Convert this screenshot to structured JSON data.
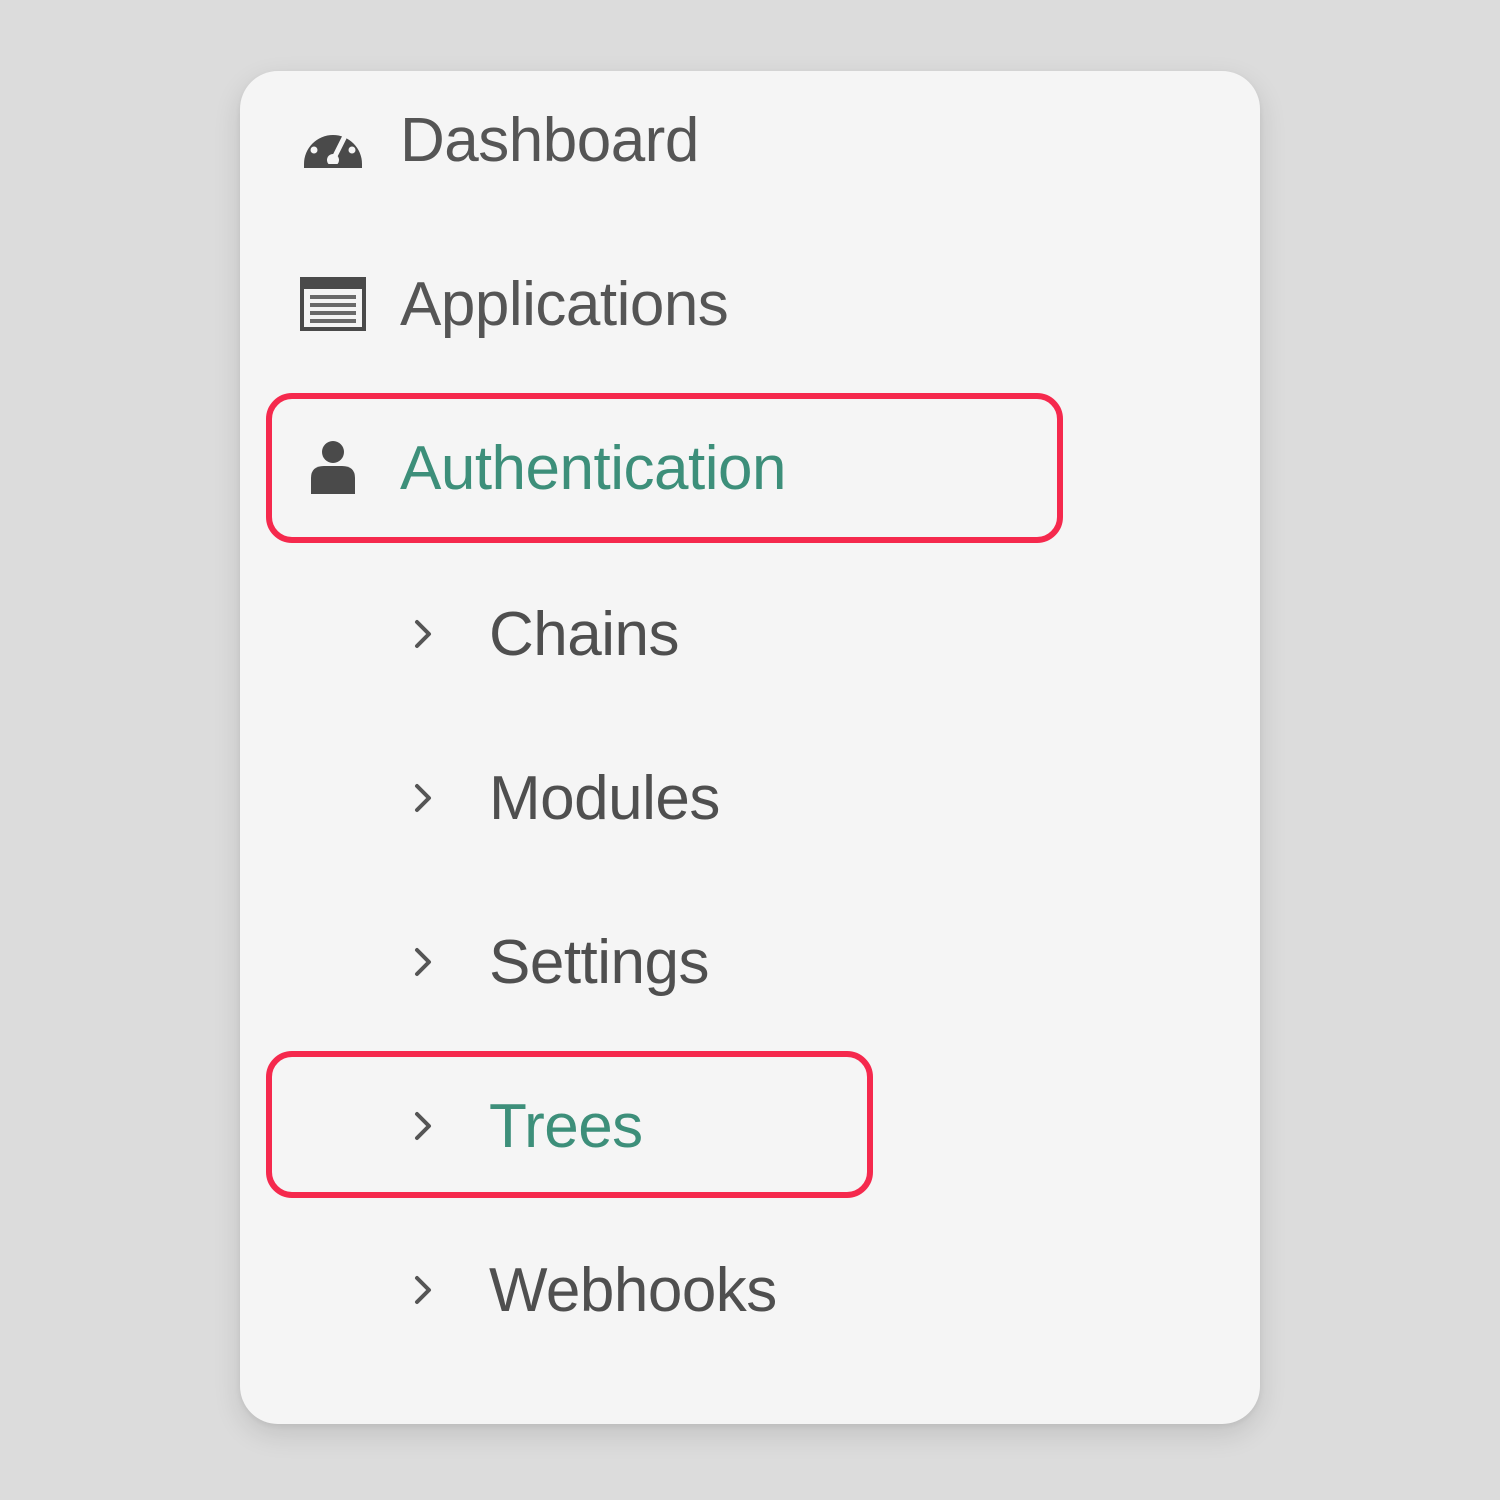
{
  "colors": {
    "background": "#dcdcdc",
    "panel": "#f5f5f5",
    "text": "#555555",
    "active_text": "#3d8f7a",
    "icon": "#4a4a4a",
    "highlight": "#f5294d"
  },
  "nav": {
    "items": [
      {
        "label": "Dashboard",
        "icon": "speedometer-icon"
      },
      {
        "label": "Applications",
        "icon": "window-list-icon"
      },
      {
        "label": "Authentication",
        "icon": "user-icon",
        "active": true,
        "highlighted": true
      }
    ],
    "subitems": [
      {
        "label": "Chains",
        "icon": "chevron-right-icon"
      },
      {
        "label": "Modules",
        "icon": "chevron-right-icon"
      },
      {
        "label": "Settings",
        "icon": "chevron-right-icon"
      },
      {
        "label": "Trees",
        "icon": "chevron-right-icon",
        "active": true,
        "highlighted": true
      },
      {
        "label": "Webhooks",
        "icon": "chevron-right-icon"
      }
    ]
  }
}
